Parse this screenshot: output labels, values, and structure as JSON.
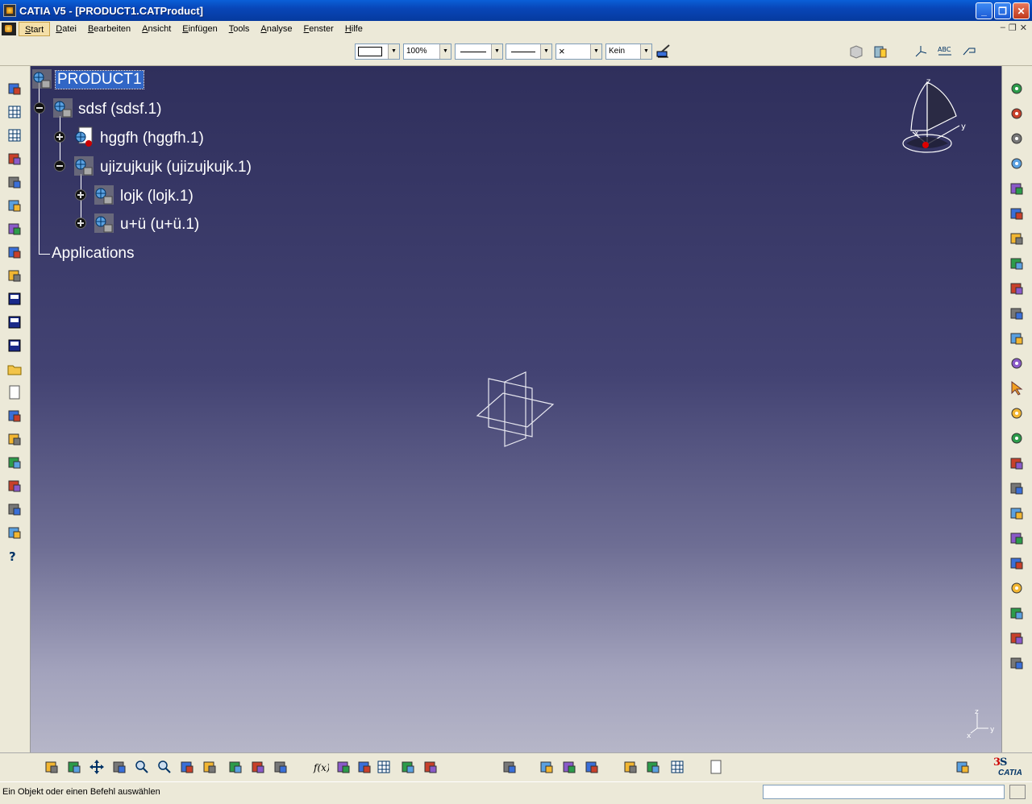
{
  "window": {
    "title": "CATIA V5 - [PRODUCT1.CATProduct]"
  },
  "menu": {
    "items": [
      "Start",
      "Datei",
      "Bearbeiten",
      "Ansicht",
      "Einfügen",
      "Tools",
      "Analyse",
      "Fenster",
      "Hilfe"
    ]
  },
  "toolbar": {
    "color_combo": "",
    "transparency_combo": "100%",
    "linetype_combo": "",
    "thickness_combo": "",
    "point_combo": "×",
    "layer_combo": "Kein"
  },
  "tree": {
    "root": "PRODUCT1",
    "nodes": [
      "sdsf (sdsf.1)",
      "hggfh (hggfh.1)",
      "ujizujkujk (ujizujkujk.1)",
      "lojk (lojk.1)",
      "u+ü (u+ü.1)"
    ],
    "applications": "Applications"
  },
  "compass": {
    "z": "z",
    "y": "y",
    "x": "x"
  },
  "axis": {
    "z": "z",
    "x": "x",
    "y": "y"
  },
  "status": {
    "text": "Ein Objekt oder einen Befehl auswählen",
    "input": ""
  },
  "brand": {
    "name": "CATIA"
  },
  "colors": {
    "accent": "#3166c6",
    "viewport_top": "#2f2f5c",
    "viewport_bottom": "#b6b6c8"
  },
  "icons": {
    "left": [
      "sketch-icon",
      "table-icon",
      "table-icon",
      "ruler-icon",
      "product-icon",
      "components-icon",
      "constraint-icon",
      "analysis-icon",
      "globe-icon",
      "pdf-icon",
      "v4-icon",
      "dxf-icon",
      "open-folder-icon",
      "new-doc-icon",
      "print-icon",
      "cut-icon",
      "copy-icon",
      "paste-icon",
      "undo-icon",
      "redo-icon",
      "help-icon"
    ],
    "right": [
      "gear-icon",
      "gear-icon",
      "gear-icon",
      "gear-icon",
      "import-icon",
      "swap-icon",
      "reorder-icon",
      "replace-icon",
      "text-icon",
      "tree-icon",
      "component-icon",
      "gear-icon",
      "select-icon",
      "gear-icon",
      "gear-icon",
      "explode-icon",
      "fix-icon",
      "cube-icon",
      "pen-icon",
      "box-icon",
      "gear-icon",
      "anchor-icon",
      "pen-icon",
      "frame-icon"
    ],
    "bottom": [
      "fly-icon",
      "fit-all-icon",
      "pan-icon",
      "rotate-icon",
      "zoom-in-icon",
      "zoom-out-icon",
      "normal-view-icon",
      "iso-view-icon",
      "shading-icon",
      "hide-icon",
      "swap-visible-icon",
      "formula-icon",
      "comment-icon",
      "light-icon",
      "table-icon",
      "lock-icon",
      "chart-icon",
      "catalog-icon",
      "measure-icon",
      "inertia-icon",
      "weight-icon",
      "camera-icon",
      "sun-icon",
      "grid-icon",
      "book-icon",
      "refresh-icon",
      "catia-logo-icon"
    ]
  }
}
